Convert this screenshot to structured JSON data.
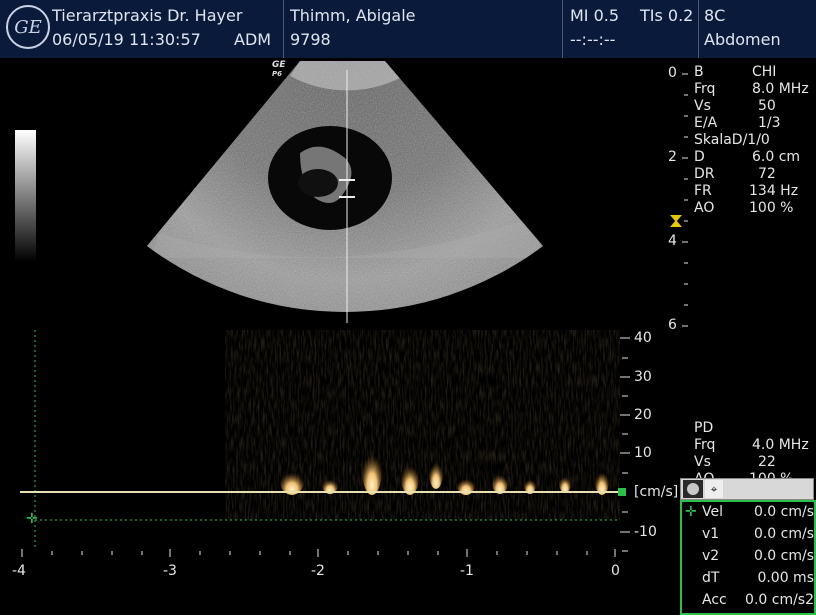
{
  "header": {
    "clinic": "Tierarztpraxis Dr. Hayer",
    "datetime": "06/05/19 11:30:57",
    "operator": "ADM",
    "patient_name": "Thimm, Abigale",
    "patient_id": "9798",
    "mi": "MI 0.5",
    "tis": "TIs 0.2",
    "probe": "8C",
    "timer": "--:--:--",
    "preset": "Abdomen",
    "logo_text": "GE"
  },
  "image": {
    "orientation_mark": "GE",
    "orientation_sub": "P6"
  },
  "depth_scale": {
    "labels": [
      "0",
      "2",
      "4",
      "6"
    ]
  },
  "bmode_params": [
    {
      "k": "B",
      "v": "CHI"
    },
    {
      "k": "Frq",
      "v": "8.0 MHz"
    },
    {
      "k": "Vs",
      "v": "50"
    },
    {
      "k": "E/A",
      "v": "1/3"
    },
    {
      "k": "SkalaD/1/0",
      "v": ""
    },
    {
      "k": "D",
      "v": "6.0 cm"
    },
    {
      "k": "DR",
      "v": "72"
    },
    {
      "k": "FR",
      "v": "134 Hz"
    },
    {
      "k": "AO",
      "v": "100 %"
    }
  ],
  "pd_params": [
    {
      "k": "PD",
      "v": ""
    },
    {
      "k": "Frq",
      "v": "4.0 MHz"
    },
    {
      "k": "Vs",
      "v": "22"
    },
    {
      "k": "AO",
      "v": "100 %"
    }
  ],
  "spectrum": {
    "velocity_labels": [
      "40",
      "30",
      "20",
      "10",
      "-10"
    ],
    "unit": "[cm/s]",
    "time_labels": [
      "-4",
      "-3",
      "-2",
      "-1",
      "0"
    ]
  },
  "measurements": [
    {
      "k": "Vel",
      "v": "0.0 cm/s"
    },
    {
      "k": "v1",
      "v": "0.0 cm/s"
    },
    {
      "k": "v2",
      "v": "0.0 cm/s"
    },
    {
      "k": "dT",
      "v": "0.00 ms"
    },
    {
      "k": "Acc",
      "v": "0.0 cm/s2"
    }
  ],
  "colors": {
    "header_bg": "#0a1a3a",
    "accent_green": "#2bc04a",
    "baseline": "#e8e0b0",
    "doppler_signal": "#f0c070"
  }
}
